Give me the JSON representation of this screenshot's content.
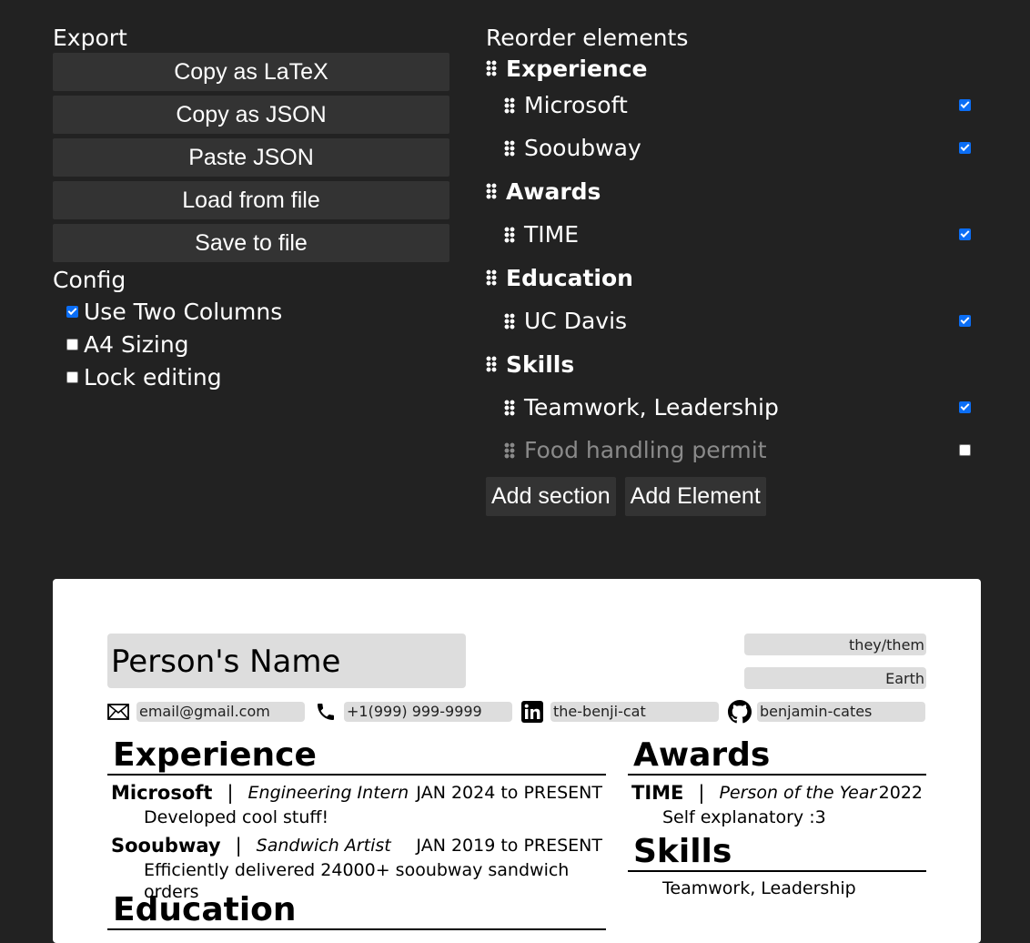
{
  "export": {
    "heading": "Export",
    "buttons": [
      "Copy as LaTeX",
      "Copy as JSON",
      "Paste JSON",
      "Load from file",
      "Save to file"
    ]
  },
  "config": {
    "heading": "Config",
    "options": [
      {
        "label": "Use Two Columns",
        "checked": true
      },
      {
        "label": "A4 Sizing",
        "checked": false
      },
      {
        "label": "Lock editing",
        "checked": false
      }
    ]
  },
  "reorder": {
    "heading": "Reorder elements",
    "sections": [
      {
        "title": "Experience",
        "items": [
          {
            "label": "Microsoft",
            "checked": true
          },
          {
            "label": "Sooubway",
            "checked": true
          }
        ]
      },
      {
        "title": "Awards",
        "items": [
          {
            "label": "TIME",
            "checked": true
          }
        ]
      },
      {
        "title": "Education",
        "items": [
          {
            "label": "UC Davis",
            "checked": true
          }
        ]
      },
      {
        "title": "Skills",
        "items": [
          {
            "label": "Teamwork, Leadership",
            "checked": true
          },
          {
            "label": "Food handling permit",
            "checked": false
          }
        ]
      }
    ],
    "add_section_label": "Add section",
    "add_element_label": "Add Element"
  },
  "resume": {
    "name": "Person's Name",
    "pronouns": "they/them",
    "location": "Earth",
    "email": "email@gmail.com",
    "phone": "+1(999) 999-9999",
    "linkedin": "the-benji-cat",
    "github": "benjamin-cates",
    "experience": {
      "title": "Experience",
      "entries": [
        {
          "org": "Microsoft",
          "sep": "|",
          "role": "Engineering Intern",
          "date": "JAN 2024 to PRESENT",
          "desc": "Developed cool stuff!"
        },
        {
          "org": "Sooubway",
          "sep": "|",
          "role": "Sandwich Artist",
          "date": "JAN 2019 to PRESENT",
          "desc": "Efficiently delivered 24000+ sooubway sandwich orders"
        }
      ]
    },
    "education_title": "Education",
    "awards": {
      "title": "Awards",
      "entries": [
        {
          "org": "TIME",
          "sep": "|",
          "role": "Person of the Year",
          "date": "2022",
          "desc": "Self explanatory :3"
        }
      ]
    },
    "skills": {
      "title": "Skills",
      "line": "Teamwork, Leadership"
    }
  },
  "colors": {
    "background": "#222222",
    "button": "#333333",
    "accent": "#0b6ef5",
    "field": "#dddddd"
  }
}
